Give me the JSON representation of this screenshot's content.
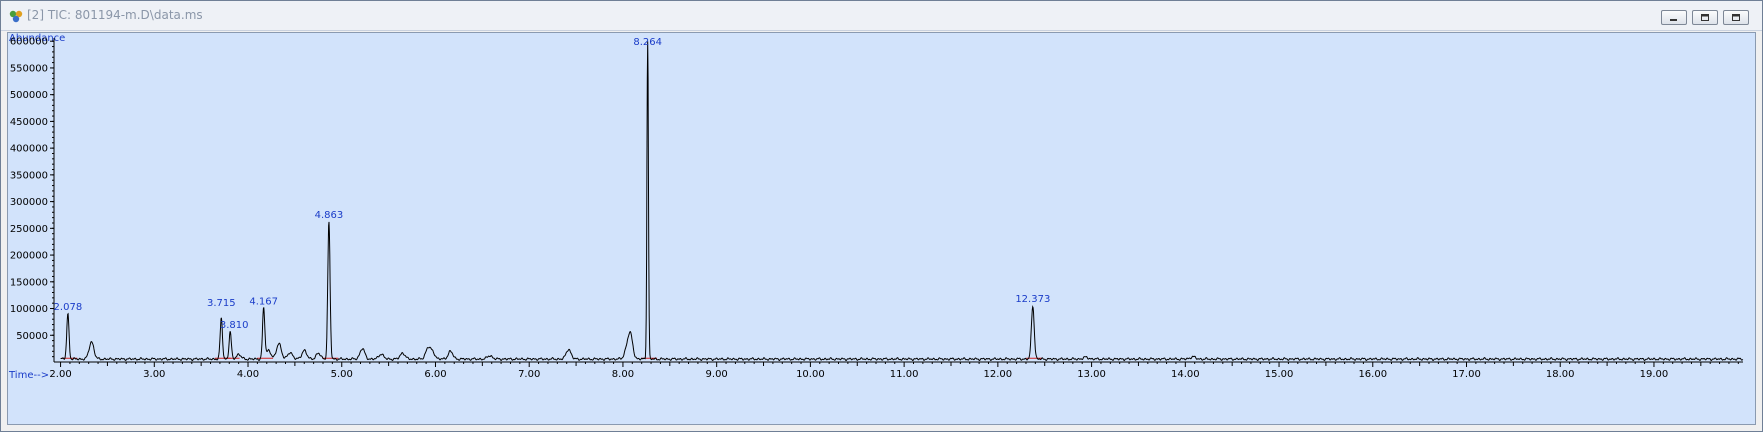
{
  "window": {
    "title": "[2] TIC: 801194-m.D\\data.ms",
    "controls": [
      "minimize-icon",
      "restore-icon",
      "close-icon"
    ]
  },
  "colors": {
    "plot_bg": "#d2e3fb",
    "trace": "#000000",
    "peak_label": "#1a3cc8",
    "baseline_marker": "#d02020",
    "axis_label": "#1a3cc8"
  },
  "chart_data": {
    "type": "line",
    "ylabel": "Abundance",
    "xlabel": "Time-->",
    "xlim": [
      1.93,
      19.95
    ],
    "ylim": [
      0,
      606000
    ],
    "x_ticks": [
      "2.00",
      "3.00",
      "4.00",
      "5.00",
      "6.00",
      "7.00",
      "8.00",
      "9.00",
      "10.00",
      "11.00",
      "12.00",
      "13.00",
      "14.00",
      "15.00",
      "16.00",
      "17.00",
      "18.00",
      "19.00"
    ],
    "y_ticks": [
      "50000",
      "100000",
      "150000",
      "200000",
      "250000",
      "300000",
      "350000",
      "400000",
      "450000",
      "500000",
      "550000",
      "600000"
    ],
    "grid": false,
    "baseline": 5500,
    "peaks_labeled": [
      {
        "time": 2.078,
        "label": "2.078",
        "abundance": 90000
      },
      {
        "time": 3.715,
        "label": "3.715",
        "abundance": 82000
      },
      {
        "time": 3.81,
        "label": "3.810",
        "abundance": 56000
      },
      {
        "time": 4.167,
        "label": "4.167",
        "abundance": 100000
      },
      {
        "time": 4.863,
        "label": "4.863",
        "abundance": 262000
      },
      {
        "time": 8.264,
        "label": "8.264",
        "abundance": 600000
      },
      {
        "time": 12.373,
        "label": "12.373",
        "abundance": 105000
      }
    ],
    "peaks_minor": [
      {
        "time": 2.33,
        "abundance": 38000
      },
      {
        "time": 3.9,
        "abundance": 14000
      },
      {
        "time": 4.22,
        "abundance": 22000
      },
      {
        "time": 4.33,
        "abundance": 35000
      },
      {
        "time": 4.45,
        "abundance": 18000
      },
      {
        "time": 4.6,
        "abundance": 22000
      },
      {
        "time": 4.75,
        "abundance": 16000
      },
      {
        "time": 5.22,
        "abundance": 25000
      },
      {
        "time": 5.42,
        "abundance": 15000
      },
      {
        "time": 5.65,
        "abundance": 17000
      },
      {
        "time": 5.92,
        "abundance": 26000
      },
      {
        "time": 5.97,
        "abundance": 18000
      },
      {
        "time": 6.16,
        "abundance": 20000
      },
      {
        "time": 6.58,
        "abundance": 12000
      },
      {
        "time": 7.42,
        "abundance": 24000
      },
      {
        "time": 8.04,
        "abundance": 22000
      },
      {
        "time": 8.08,
        "abundance": 50000
      },
      {
        "time": 12.94,
        "abundance": 9000
      },
      {
        "time": 14.08,
        "abundance": 10000
      }
    ]
  }
}
